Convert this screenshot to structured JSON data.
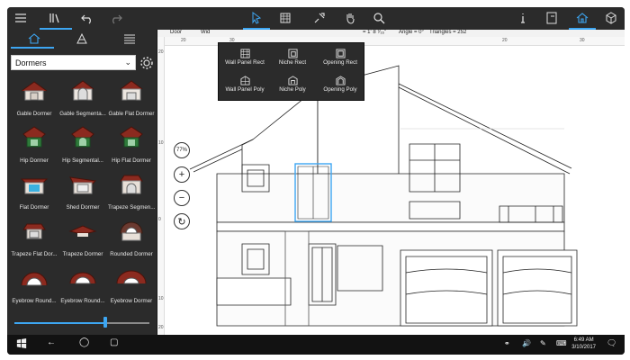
{
  "toolbar": {
    "left_icons": [
      "hamburger-icon",
      "library-icon",
      "undo-icon",
      "redo-icon"
    ],
    "center_icons": [
      "pointer-icon",
      "wall-panel-icon",
      "move-icon",
      "hand-icon",
      "search-icon"
    ],
    "right_icons": [
      "info-icon",
      "book-icon",
      "home-icon",
      "3d-cube-icon"
    ]
  },
  "panel": {
    "tabs": [
      "house-icon",
      "material-icon",
      "list-icon"
    ],
    "category": "Dormers",
    "items": [
      {
        "label": "Gable Dormer"
      },
      {
        "label": "Gable Segmenta..."
      },
      {
        "label": "Gable Flat Dormer"
      },
      {
        "label": "Hip Dormer"
      },
      {
        "label": "Hip Segmental..."
      },
      {
        "label": "Hip Flat Dormer"
      },
      {
        "label": "Flat Dormer"
      },
      {
        "label": "Shed Dormer"
      },
      {
        "label": "Trapeze Segmen..."
      },
      {
        "label": "Trapeze Flat Dor..."
      },
      {
        "label": "Trapeze Dormer"
      },
      {
        "label": "Rounded Dormer"
      },
      {
        "label": "Eyebrow Round..."
      },
      {
        "label": "Eyebrow Round..."
      },
      {
        "label": "Eyebrow Dormer"
      }
    ],
    "slider_value": 0.67
  },
  "canvas": {
    "header": {
      "door": "Door",
      "width_cut": "Wid",
      "measure": "= 1' 8 ⁷⁄₁₆\"",
      "angle": "Angle = 0°",
      "triangles": "Triangles = 252"
    },
    "ruler_top": [
      "20",
      "30",
      "20",
      "30"
    ],
    "ruler_left": [
      "20",
      "10",
      "0",
      "10",
      "20"
    ],
    "zoom": "77%",
    "popup": [
      {
        "label": "Wall Panel Rect"
      },
      {
        "label": "Niche Rect"
      },
      {
        "label": "Opening Rect"
      },
      {
        "label": "Wall Panel Poly"
      },
      {
        "label": "Niche Poly"
      },
      {
        "label": "Opening Poly"
      }
    ]
  },
  "taskbar": {
    "time": "6:49 AM",
    "date": "3/10/2017",
    "tray_icons": [
      "people-icon",
      "volume-icon",
      "pen-icon",
      "keyboard-icon",
      "notification-icon"
    ]
  },
  "colors": {
    "accent": "#3da6f2",
    "roof_red": "#8b2a1f",
    "frame_dark": "#2b2b2b"
  }
}
